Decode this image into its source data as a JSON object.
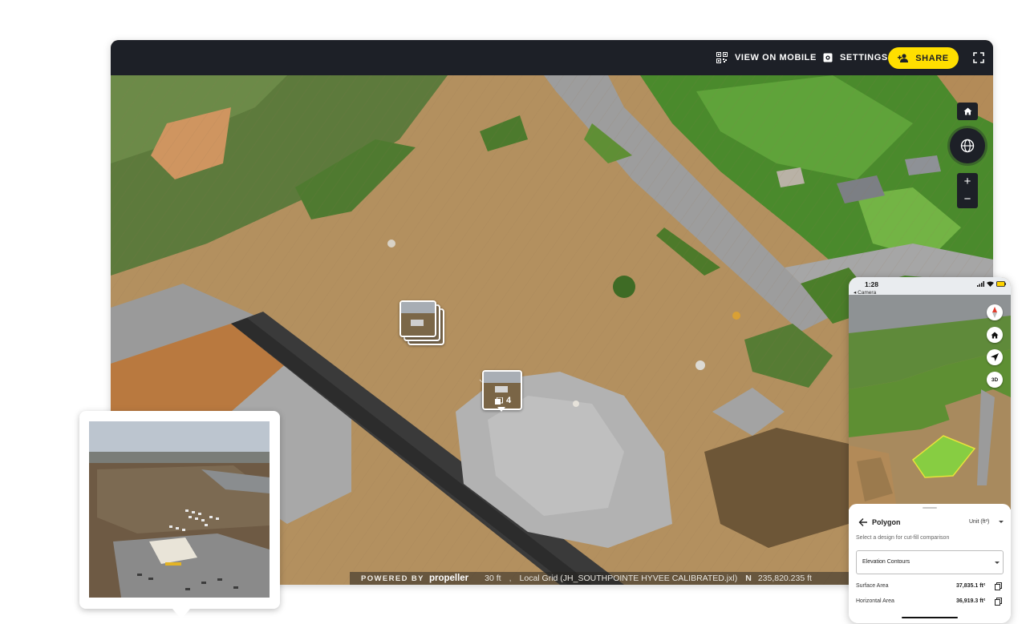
{
  "toolbar": {
    "view_on_mobile": "VIEW ON MOBILE",
    "settings": "SETTINGS",
    "share": "SHARE",
    "share_color": "#FFDF00",
    "bar_color": "#1D2027",
    "icons": [
      "qr-code-icon",
      "gear-icon",
      "add-user-icon",
      "fullscreen-icon"
    ]
  },
  "map_controls": {
    "zoom_in": "+",
    "zoom_out": "−",
    "icons": [
      "home-icon",
      "globe-icon"
    ]
  },
  "photo_marker": {
    "count": "4"
  },
  "statusbar": {
    "powered_by": "POWERED BY",
    "brand": "propeller",
    "scale": "30 ft",
    "grid": "Local Grid (JH_SOUTHPOINTE HYVEE CALIBRATED.jxl)",
    "northing_label": "N",
    "northing": "235,820.235 ft"
  },
  "phone": {
    "time": "1:28",
    "back_link": "◂ Camera",
    "mode_3d": "3D",
    "panel": {
      "title": "Polygon",
      "unit": "Unit (ft³)",
      "hint": "Select a design for cut-fill comparison",
      "design_select": "Elevation Contours",
      "rows": [
        {
          "label": "Surface Area",
          "value": "37,835.1 ft²"
        },
        {
          "label": "Horizontal Area",
          "value": "36,919.3 ft²"
        }
      ]
    },
    "polygon_color": "#7CE33A"
  }
}
